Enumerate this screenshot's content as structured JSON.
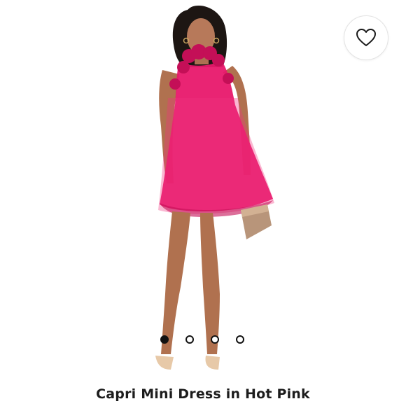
{
  "product": {
    "title": "Capri Mini Dress in Hot Pink",
    "image_alt": "model wearing hot pink ruffled halter mini dress"
  },
  "favorite": {
    "icon": "heart-outline-icon"
  },
  "carousel": {
    "total": 4,
    "active_index": 0
  },
  "colors": {
    "dress": "#e8186c",
    "dress_dark": "#c40f57",
    "accent": "#111111"
  }
}
